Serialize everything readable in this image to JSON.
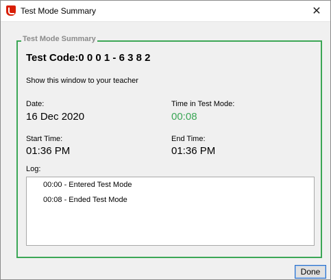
{
  "window": {
    "title": "Test Mode Summary",
    "close_glyph": "✕",
    "app_icon": "app-logo-icon",
    "accent_color": "#3aa655"
  },
  "summary": {
    "group_title": "Test Mode Summary",
    "test_code": "Test Code:0 0 0 1 - 6 3 8 2",
    "instruction": "Show this window to your teacher",
    "date_label": "Date:",
    "date_value": "16 Dec 2020",
    "time_in_test_label": "Time in Test Mode:",
    "time_in_test_value": "00:08",
    "start_label": "Start Time:",
    "start_value": "01:36 PM",
    "end_label": "End Time:",
    "end_value": "01:36 PM",
    "log_label": "Log:",
    "log_entries": [
      "00:00 - Entered Test Mode",
      "00:08 - Ended Test Mode"
    ]
  },
  "footer": {
    "done_label": "Done"
  }
}
